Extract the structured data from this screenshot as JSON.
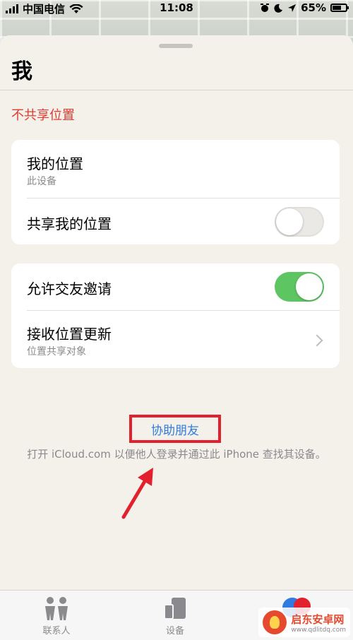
{
  "status": {
    "carrier": "中国电信",
    "time": "11:08",
    "battery": "65%"
  },
  "sheet": {
    "title": "我",
    "section_label": "不共享位置"
  },
  "card1": {
    "my_location_title": "我的位置",
    "my_location_sub": "此设备",
    "share_title": "共享我的位置",
    "share_on": false
  },
  "card2": {
    "allow_title": "允许交友邀请",
    "allow_on": true,
    "receive_title": "接收位置更新",
    "receive_sub": "位置共享对象"
  },
  "help": {
    "link": "协助朋友",
    "desc": "打开 iCloud.com 以便他人登录并通过此 iPhone 查找其设备。"
  },
  "tabs": [
    {
      "label": "联系人",
      "icon": "people-icon"
    },
    {
      "label": "设备",
      "icon": "devices-icon"
    },
    {
      "label": "",
      "icon": "me-icon"
    }
  ],
  "watermark": {
    "brand": "启东安卓网",
    "url": "www.qdlitdq.com"
  },
  "colors": {
    "red": "#e3202e",
    "green": "#5dc561",
    "blue": "#2f7be0"
  }
}
